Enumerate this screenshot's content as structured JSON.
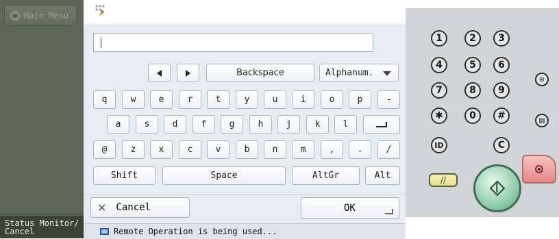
{
  "sidebar": {
    "main_menu_label": "Main Menu",
    "status_monitor_label": "Status Monitor/\nCancel"
  },
  "input": {
    "value": ""
  },
  "keyboard": {
    "nav": {
      "backspace": "Backspace",
      "mode": "Alphanum."
    },
    "row1": [
      "q",
      "w",
      "e",
      "r",
      "t",
      "y",
      "u",
      "i",
      "o",
      "p",
      "-"
    ],
    "row2": [
      "a",
      "s",
      "d",
      "f",
      "g",
      "h",
      "j",
      "k",
      "l"
    ],
    "row3": [
      "@",
      "z",
      "x",
      "c",
      "v",
      "b",
      "n",
      "m",
      ",",
      ".",
      "/"
    ],
    "row4": {
      "shift": "Shift",
      "space": "Space",
      "altgr": "AltGr",
      "alt": "Alt"
    }
  },
  "actions": {
    "cancel": "Cancel",
    "ok": "OK"
  },
  "status": {
    "message": "Remote Operation is being used..."
  },
  "hardware": {
    "numkeys": [
      "1",
      "2",
      "3",
      "4",
      "5",
      "6",
      "7",
      "8",
      "9",
      "✱",
      "0",
      "#"
    ],
    "id_label": "ID",
    "clear_label": "C",
    "reset_label": "//"
  },
  "colors": {
    "sidebar": "#5d6658",
    "start": "#8bcaa8",
    "stop": "#e88686",
    "reset": "#e4de86"
  }
}
